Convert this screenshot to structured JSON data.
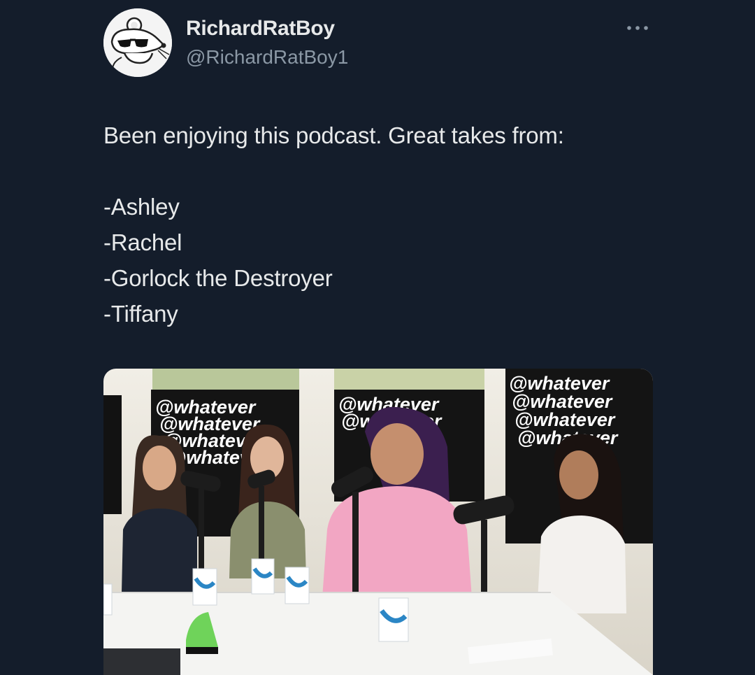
{
  "author": {
    "display_name": "RichardRatBoy",
    "handle": "@RichardRatBoy1",
    "avatar_icon": "rat-with-sunglasses-avatar"
  },
  "more_menu_icon": "more-horizontal-icon",
  "tweet": {
    "lines": [
      "Been enjoying this podcast. Great takes from:",
      "",
      "-Ashley",
      "-Rachel",
      "-Gorlock the Destroyer",
      "-Tiffany"
    ]
  },
  "media": {
    "backdrop_text": "@whatever",
    "description_icon": "podcast-studio-photo"
  },
  "colors": {
    "background": "#141d2b",
    "primary_text": "#e7e9ea",
    "secondary_text": "#8b98a5"
  }
}
